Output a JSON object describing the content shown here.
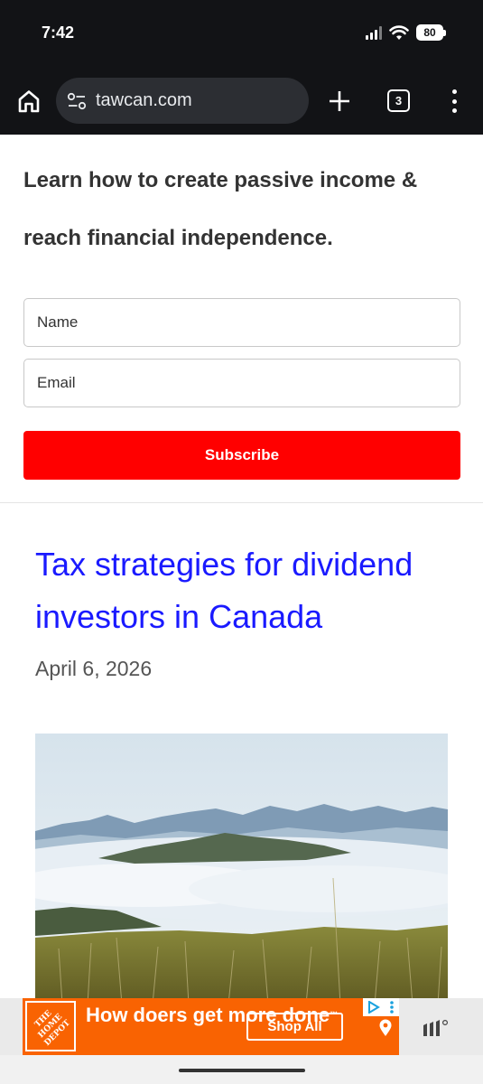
{
  "status_bar": {
    "time": "7:42",
    "battery": "80"
  },
  "browser": {
    "url": "tawcan.com",
    "tab_count": "3"
  },
  "signup": {
    "heading": "Learn how to create passive income & reach financial independence.",
    "name_placeholder": "Name",
    "email_placeholder": "Email",
    "subscribe_label": "Subscribe"
  },
  "post": {
    "title": "Tax strategies for dividend investors in Canada",
    "date": "April 6, 2026"
  },
  "ad": {
    "logo_text": "THE HOME DEPOT",
    "headline": "How doers get more done",
    "headline_mark": "™",
    "cta": "Shop All"
  },
  "colors": {
    "chrome_bg": "#121316",
    "subscribe_bg": "#ff0000",
    "post_link": "#1a1aff",
    "ad_brand": "#f96302"
  },
  "icons": [
    "home-icon",
    "site-settings-icon",
    "plus-icon",
    "tab-switcher-icon",
    "more-vert-icon",
    "adchoices-icon",
    "location-pin-icon"
  ]
}
